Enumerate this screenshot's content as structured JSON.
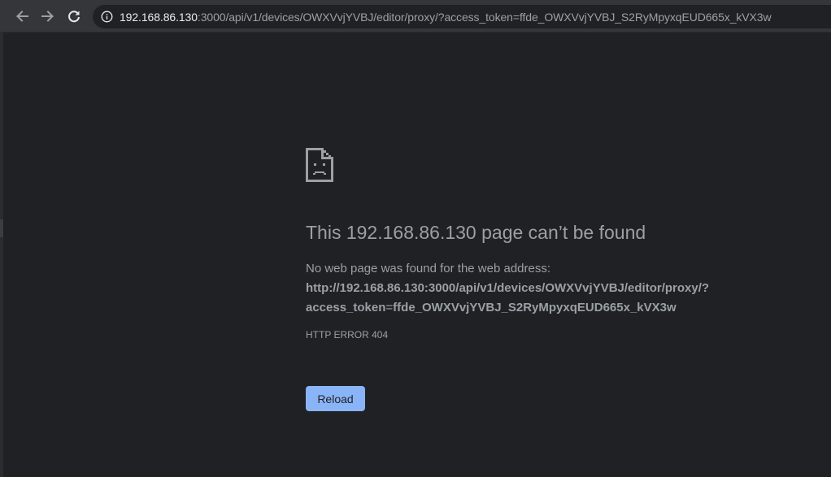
{
  "toolbar": {
    "back_icon": "arrow-left-icon",
    "forward_icon": "arrow-right-icon",
    "reload_icon": "reload-icon",
    "site_info_icon": "info-icon",
    "url_host": "192.168.86.130",
    "url_rest": ":3000/api/v1/devices/OWXVvjYVBJ/editor/proxy/?access_token=ffde_OWXVvjYVBJ_S2RyMpyxqEUD665x_kVX3w"
  },
  "error_page": {
    "icon": "sad-page-icon",
    "title": "This 192.168.86.130 page can’t be found",
    "description": "No web page was found for the web address:",
    "url_part1": "http://192.168.86.130:3000/api/v1/devices/OWXVvjYVBJ/editor/proxy/?",
    "url_part2_a": "access_token",
    "url_part2_eq": "=",
    "url_part2_b": "ffde_OWXVvjYVBJ_S2RyMpyxqEUD665x_kVX3w",
    "error_code": "HTTP ERROR 404",
    "reload_label": "Reload"
  },
  "colors": {
    "background": "#202124",
    "toolbar": "#35363a",
    "text": "#9aa0a6",
    "button": "#8ab4f8"
  }
}
